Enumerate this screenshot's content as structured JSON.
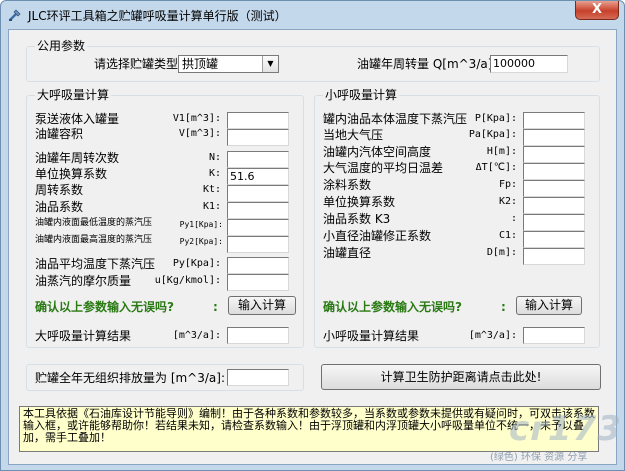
{
  "window": {
    "title": "JLC环评工具箱之贮罐呼吸量计算单行版（测试）",
    "close_glyph": "X"
  },
  "common": {
    "group_title": "公用参数",
    "tank_type_label": "请选择贮罐类型:",
    "tank_type_value": "拱顶罐",
    "turnover_label": "油罐年周转量 Q[m^3/a]:",
    "turnover_value": "100000"
  },
  "big": {
    "group_title": "大呼吸量计算",
    "rows": [
      {
        "label": "泵送液体入罐量",
        "sym": "V1[m^3]:",
        "value": ""
      },
      {
        "label": "油罐容积",
        "sym": "V[m^3]:",
        "value": ""
      },
      {
        "label": "油罐年周转次数",
        "sym": "N:",
        "value": ""
      },
      {
        "label": "单位换算系数",
        "sym": "K:",
        "value": "51.6"
      },
      {
        "label": "周转系数",
        "sym": "Kt:",
        "value": ""
      },
      {
        "label": "油品系数",
        "sym": "K1:",
        "value": ""
      },
      {
        "label": "油罐内液面最低温度的蒸汽压",
        "sym": "Py1[Kpa]:",
        "value": ""
      },
      {
        "label": "油罐内液面最高温度的蒸汽压",
        "sym": "Py2[Kpa]:",
        "value": ""
      },
      {
        "label": "油品平均温度下蒸汽压",
        "sym": "Py[Kpa]:",
        "value": ""
      },
      {
        "label": "油蒸汽的摩尔质量",
        "sym": "u[Kg/kmol]:",
        "value": ""
      }
    ],
    "confirm": "确认以上参数输入无误吗?",
    "confirm_colon": ":",
    "calc_button": "输入计算",
    "result_label": "大呼吸量计算结果",
    "result_unit": "[m^3/a]:",
    "result_value": ""
  },
  "small": {
    "group_title": "小呼吸量计算",
    "rows": [
      {
        "label": "罐内油品本体温度下蒸汽压",
        "sym": "P[Kpa]:",
        "value": ""
      },
      {
        "label": "当地大气压",
        "sym": "Pa[Kpa]:",
        "value": ""
      },
      {
        "label": "油罐内汽体空间高度",
        "sym": "H[m]:",
        "value": ""
      },
      {
        "label": "大气温度的平均日温差",
        "sym": "ΔT[℃]:",
        "value": ""
      },
      {
        "label": "涂料系数",
        "sym": "Fp:",
        "value": ""
      },
      {
        "label": "单位换算系数",
        "sym": "K2:",
        "value": ""
      },
      {
        "label": "油品系数 K3",
        "sym": ":",
        "value": ""
      },
      {
        "label": "小直径油罐修正系数",
        "sym": "C1:",
        "value": ""
      },
      {
        "label": "油罐直径",
        "sym": "D[m]:",
        "value": ""
      }
    ],
    "confirm": "确认以上参数输入无误吗?",
    "confirm_colon": ":",
    "calc_button": "输入计算",
    "result_label": "小呼吸量计算结果",
    "result_unit": "[m^3/a]:",
    "result_value": ""
  },
  "annual": {
    "label": "贮罐全年无组织排放量为 [m^3/a]:",
    "value": "",
    "distance_button": "计算卫生防护距离请点击此处!"
  },
  "notes_text": "本工具依据《石油库设计节能导则》编制！由于各种系数和参数较多，当系数或参数未提供或有疑问时，可双击该系数输入框，或许能够帮助你！若结果未知，请检查系数输入！由于浮顶罐和内浮顶罐大小呼吸量单位不统一，未予以叠加，需手工叠加！",
  "watermark": {
    "logo": "cr173",
    "text": "(绿色) 环保 资源 分享"
  }
}
